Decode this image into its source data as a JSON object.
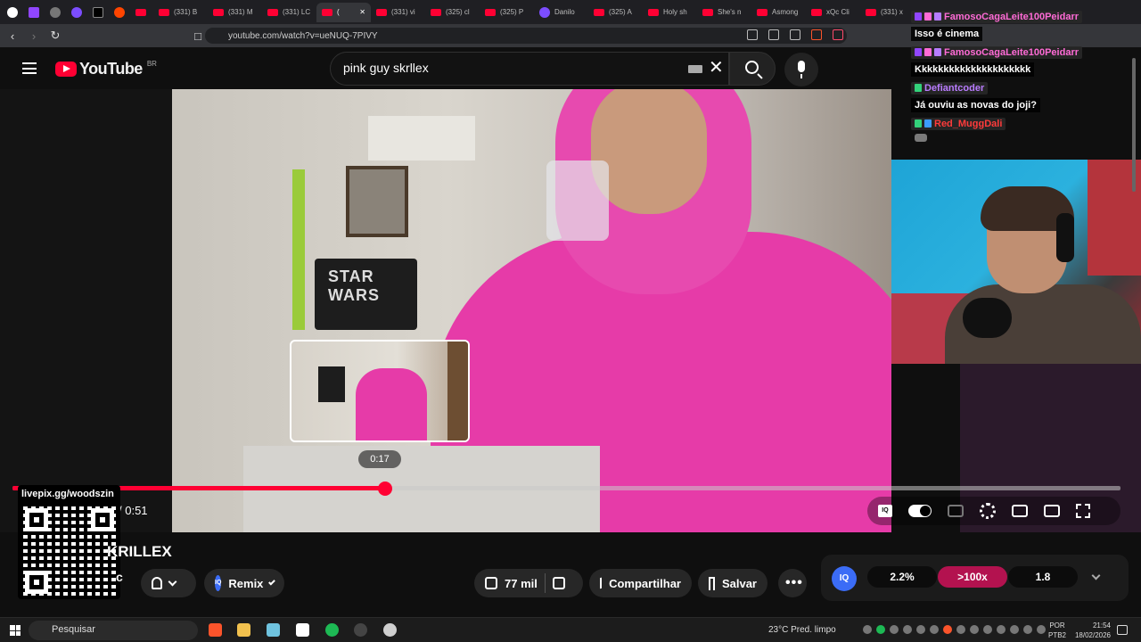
{
  "browser": {
    "tabs": [
      {
        "label": "",
        "icon": "chrome-menu-icon",
        "kind": "small"
      },
      {
        "label": "",
        "icon": "twitch-icon",
        "kind": "small"
      },
      {
        "label": "",
        "icon": "mute-icon",
        "kind": "small"
      },
      {
        "label": "",
        "icon": "app-icon",
        "kind": "small"
      },
      {
        "label": "",
        "icon": "x-icon",
        "kind": "small"
      },
      {
        "label": "",
        "icon": "reddit-icon",
        "kind": "small"
      },
      {
        "label": "",
        "icon": "youtube-icon",
        "kind": "small"
      },
      {
        "label": "(331) B",
        "icon": "youtube-icon"
      },
      {
        "label": "(331) M",
        "icon": "youtube-icon"
      },
      {
        "label": "(331) LC",
        "icon": "youtube-icon"
      },
      {
        "label": "(",
        "icon": "youtube-icon",
        "active": true
      },
      {
        "label": "(331) vi",
        "icon": "youtube-icon"
      },
      {
        "label": "(325) cl",
        "icon": "youtube-icon"
      },
      {
        "label": "(325) P",
        "icon": "youtube-icon"
      },
      {
        "label": "Danilo",
        "icon": "app-icon"
      },
      {
        "label": "(325) A",
        "icon": "youtube-icon"
      },
      {
        "label": "Holy sh",
        "icon": "youtube-icon"
      },
      {
        "label": "She's n",
        "icon": "youtube-icon"
      },
      {
        "label": "Asmong",
        "icon": "youtube-icon"
      },
      {
        "label": "xQc Cli",
        "icon": "youtube-icon"
      },
      {
        "label": "(331) x",
        "icon": "youtube-icon"
      }
    ],
    "url": "youtube.com/watch?v=ueNUQ-7PIVY"
  },
  "youtube": {
    "logo_text": "YouTube",
    "country_code": "BR",
    "search_value": "pink guy skrllex"
  },
  "player": {
    "frame_text": "STAR WARS",
    "preview_time": "0:17",
    "time_display": "/ 0:51",
    "progress_fraction": 0.336
  },
  "video": {
    "title_visible": "KRILLEX",
    "channel_fragment": "c",
    "remix_label": "Remix",
    "like_count": "77 mil",
    "share_label": "Compartilhar",
    "save_label": "Salvar"
  },
  "overlay": {
    "qr_label": "livepix.gg/woodszin"
  },
  "iq_widget": {
    "logo": "IQ",
    "values": [
      "2.2%",
      ">100x",
      "1.8"
    ]
  },
  "chat": [
    {
      "user": "FamosoCagaLeite100Peidarr",
      "color": "#ff6bd6",
      "text": "Isso é cinema"
    },
    {
      "user": "FamosoCagaLeite100Peidarr",
      "color": "#ff6bd6",
      "text": "Kkkkkkkkkkkkkkkkkkkkk"
    },
    {
      "user": "Defiantcoder",
      "color": "#b97cff",
      "text": "Já ouviu as novas do joji?"
    },
    {
      "user": "Red_MuggDali",
      "color": "#ff3b3b",
      "text": ""
    }
  ],
  "taskbar": {
    "search_placeholder": "Pesquisar",
    "weather": "23°C  Pred. limpo",
    "lang_1": "POR",
    "lang_2": "PTB2",
    "time": "21:54",
    "date": "18/02/2026"
  },
  "colors": {
    "accent": "#ff0033",
    "iq_blue": "#3b6cf6",
    "iq_hot": "#b3124f"
  }
}
